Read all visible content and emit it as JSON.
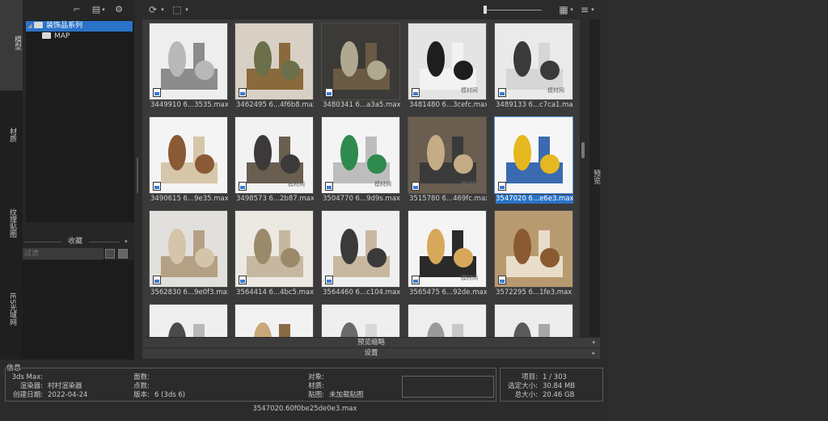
{
  "left_tabs": {
    "tab1": "模型",
    "tab2": "材质",
    "tab3": "纹理贴图",
    "tab4": "IES光域网"
  },
  "tree": {
    "root_label": "装饰品系列",
    "child_label": "MAP"
  },
  "favorites": {
    "header": "收藏",
    "filter_placeholder": "过滤"
  },
  "items": [
    {
      "caption": "3449910 6...3535.max",
      "palette": [
        "#eeeeee",
        "#b8b8b8",
        "#8c8c8c"
      ]
    },
    {
      "caption": "3462495 6...4f6b8.max",
      "palette": [
        "#d8d0c4",
        "#6b6f4a",
        "#8a6a3c"
      ]
    },
    {
      "caption": "3480341 6...a3a5.max",
      "palette": [
        "#3c3a36",
        "#b0a890",
        "#6a5a44"
      ]
    },
    {
      "caption": "3481480 6...3cefc.max",
      "palette": [
        "#e4e4e4",
        "#1e1e1e",
        "#f2f2f2"
      ]
    },
    {
      "caption": "3489133 6...c7ca1.max",
      "palette": [
        "#eaeaea",
        "#3a3a3a",
        "#d6d6d6"
      ]
    },
    {
      "caption": "3490615 6...9e35.max",
      "palette": [
        "#f4f4f4",
        "#8a5a34",
        "#d6c6aa"
      ]
    },
    {
      "caption": "3498573 6...2b87.max",
      "palette": [
        "#f2f2f2",
        "#3c3a38",
        "#6a5e50"
      ]
    },
    {
      "caption": "3504770 6...9d9s.max",
      "palette": [
        "#f4f4f4",
        "#2e8a4e",
        "#bdbdbd"
      ]
    },
    {
      "caption": "3515780 6...469fc.max",
      "palette": [
        "#6a5e50",
        "#c4ac86",
        "#3a3a3a"
      ]
    },
    {
      "caption": "3547020 6...e6e3.max",
      "palette": [
        "#f6f6f6",
        "#e6b820",
        "#3a6ab0"
      ]
    },
    {
      "caption": "3562830 6...9e0f3.max",
      "palette": [
        "#e2e0dc",
        "#d4c4aa",
        "#b4a084"
      ]
    },
    {
      "caption": "3564414 6...4bc5.max",
      "palette": [
        "#ece8e2",
        "#9a8a6a",
        "#c6b8a0"
      ]
    },
    {
      "caption": "3564460 6...c104.max",
      "palette": [
        "#efefef",
        "#3a3a3a",
        "#c8b8a0"
      ]
    },
    {
      "caption": "3565475 6...92de.max",
      "palette": [
        "#f4f4f4",
        "#d8a85a",
        "#2a2a2a"
      ]
    },
    {
      "caption": "3572295 6...1fe3.max",
      "palette": [
        "#b89a70",
        "#8a5a30",
        "#e8ddc8"
      ]
    },
    {
      "caption": "",
      "palette": [
        "#efefef",
        "#4a4a4a",
        "#b8b8b8"
      ]
    },
    {
      "caption": "",
      "palette": [
        "#f2f2f2",
        "#c8a878",
        "#8a6a44"
      ]
    },
    {
      "caption": "",
      "palette": [
        "#efefef",
        "#6a6a6a",
        "#d8d8d8"
      ]
    },
    {
      "caption": "",
      "palette": [
        "#eeeeee",
        "#9a9a9a",
        "#c8c8c8"
      ]
    },
    {
      "caption": "",
      "palette": [
        "#ededed",
        "#5a5a5a",
        "#a8a8a8"
      ]
    }
  ],
  "watermark": "模材网",
  "right_tab": "预览",
  "preview_bar": "预览缩略",
  "settings_bar": "设置",
  "info": {
    "title": "信息",
    "left_pairs": [
      {
        "k": "3ds Max:",
        "v": ""
      },
      {
        "k": "渲染器:",
        "v": "村村渲染器"
      },
      {
        "k": "创建日期:",
        "v": "2022-04-24"
      }
    ],
    "mid_pairs": [
      {
        "k": "面数:",
        "v": ""
      },
      {
        "k": "点数:",
        "v": ""
      },
      {
        "k": "版本:",
        "v": "6 (3ds 6)"
      }
    ],
    "right_pairs": [
      {
        "k": "对象:",
        "v": ""
      },
      {
        "k": "材质:",
        "v": ""
      },
      {
        "k": "贴图:",
        "v": "未加载贴图"
      }
    ],
    "stats": [
      {
        "k": "项目:",
        "v": "1 / 303"
      },
      {
        "k": "选定大小:",
        "v": "30.84 MB"
      },
      {
        "k": "总大小:",
        "v": "20.46 GB"
      }
    ],
    "filename": "3547020.60f0be25de0e3.max"
  }
}
